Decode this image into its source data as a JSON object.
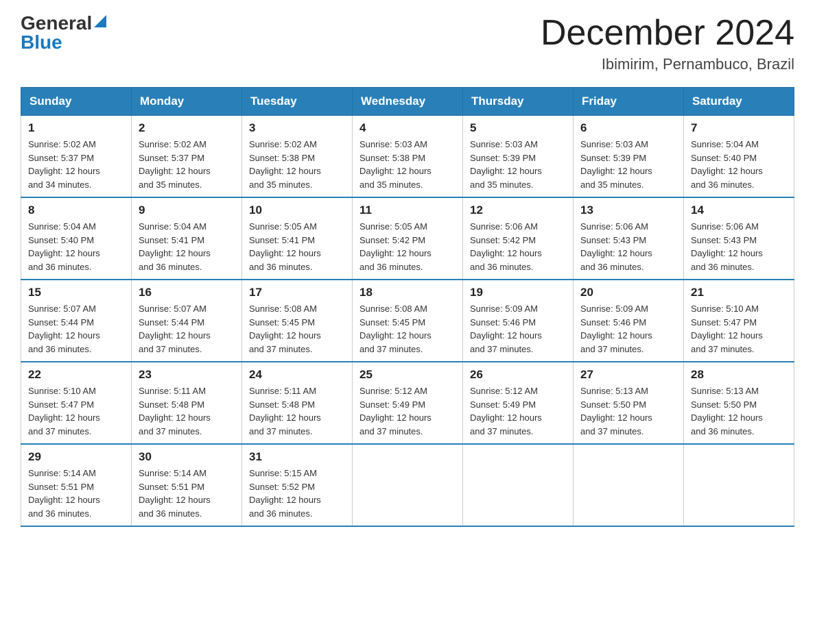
{
  "header": {
    "logo": {
      "general": "General",
      "blue": "Blue",
      "aria": "GeneralBlue logo"
    },
    "title": "December 2024",
    "subtitle": "Ibimirim, Pernambuco, Brazil"
  },
  "weekdays": [
    "Sunday",
    "Monday",
    "Tuesday",
    "Wednesday",
    "Thursday",
    "Friday",
    "Saturday"
  ],
  "weeks": [
    [
      {
        "day": "1",
        "sunrise": "5:02 AM",
        "sunset": "5:37 PM",
        "daylight": "12 hours and 34 minutes."
      },
      {
        "day": "2",
        "sunrise": "5:02 AM",
        "sunset": "5:37 PM",
        "daylight": "12 hours and 35 minutes."
      },
      {
        "day": "3",
        "sunrise": "5:02 AM",
        "sunset": "5:38 PM",
        "daylight": "12 hours and 35 minutes."
      },
      {
        "day": "4",
        "sunrise": "5:03 AM",
        "sunset": "5:38 PM",
        "daylight": "12 hours and 35 minutes."
      },
      {
        "day": "5",
        "sunrise": "5:03 AM",
        "sunset": "5:39 PM",
        "daylight": "12 hours and 35 minutes."
      },
      {
        "day": "6",
        "sunrise": "5:03 AM",
        "sunset": "5:39 PM",
        "daylight": "12 hours and 35 minutes."
      },
      {
        "day": "7",
        "sunrise": "5:04 AM",
        "sunset": "5:40 PM",
        "daylight": "12 hours and 36 minutes."
      }
    ],
    [
      {
        "day": "8",
        "sunrise": "5:04 AM",
        "sunset": "5:40 PM",
        "daylight": "12 hours and 36 minutes."
      },
      {
        "day": "9",
        "sunrise": "5:04 AM",
        "sunset": "5:41 PM",
        "daylight": "12 hours and 36 minutes."
      },
      {
        "day": "10",
        "sunrise": "5:05 AM",
        "sunset": "5:41 PM",
        "daylight": "12 hours and 36 minutes."
      },
      {
        "day": "11",
        "sunrise": "5:05 AM",
        "sunset": "5:42 PM",
        "daylight": "12 hours and 36 minutes."
      },
      {
        "day": "12",
        "sunrise": "5:06 AM",
        "sunset": "5:42 PM",
        "daylight": "12 hours and 36 minutes."
      },
      {
        "day": "13",
        "sunrise": "5:06 AM",
        "sunset": "5:43 PM",
        "daylight": "12 hours and 36 minutes."
      },
      {
        "day": "14",
        "sunrise": "5:06 AM",
        "sunset": "5:43 PM",
        "daylight": "12 hours and 36 minutes."
      }
    ],
    [
      {
        "day": "15",
        "sunrise": "5:07 AM",
        "sunset": "5:44 PM",
        "daylight": "12 hours and 36 minutes."
      },
      {
        "day": "16",
        "sunrise": "5:07 AM",
        "sunset": "5:44 PM",
        "daylight": "12 hours and 37 minutes."
      },
      {
        "day": "17",
        "sunrise": "5:08 AM",
        "sunset": "5:45 PM",
        "daylight": "12 hours and 37 minutes."
      },
      {
        "day": "18",
        "sunrise": "5:08 AM",
        "sunset": "5:45 PM",
        "daylight": "12 hours and 37 minutes."
      },
      {
        "day": "19",
        "sunrise": "5:09 AM",
        "sunset": "5:46 PM",
        "daylight": "12 hours and 37 minutes."
      },
      {
        "day": "20",
        "sunrise": "5:09 AM",
        "sunset": "5:46 PM",
        "daylight": "12 hours and 37 minutes."
      },
      {
        "day": "21",
        "sunrise": "5:10 AM",
        "sunset": "5:47 PM",
        "daylight": "12 hours and 37 minutes."
      }
    ],
    [
      {
        "day": "22",
        "sunrise": "5:10 AM",
        "sunset": "5:47 PM",
        "daylight": "12 hours and 37 minutes."
      },
      {
        "day": "23",
        "sunrise": "5:11 AM",
        "sunset": "5:48 PM",
        "daylight": "12 hours and 37 minutes."
      },
      {
        "day": "24",
        "sunrise": "5:11 AM",
        "sunset": "5:48 PM",
        "daylight": "12 hours and 37 minutes."
      },
      {
        "day": "25",
        "sunrise": "5:12 AM",
        "sunset": "5:49 PM",
        "daylight": "12 hours and 37 minutes."
      },
      {
        "day": "26",
        "sunrise": "5:12 AM",
        "sunset": "5:49 PM",
        "daylight": "12 hours and 37 minutes."
      },
      {
        "day": "27",
        "sunrise": "5:13 AM",
        "sunset": "5:50 PM",
        "daylight": "12 hours and 37 minutes."
      },
      {
        "day": "28",
        "sunrise": "5:13 AM",
        "sunset": "5:50 PM",
        "daylight": "12 hours and 36 minutes."
      }
    ],
    [
      {
        "day": "29",
        "sunrise": "5:14 AM",
        "sunset": "5:51 PM",
        "daylight": "12 hours and 36 minutes."
      },
      {
        "day": "30",
        "sunrise": "5:14 AM",
        "sunset": "5:51 PM",
        "daylight": "12 hours and 36 minutes."
      },
      {
        "day": "31",
        "sunrise": "5:15 AM",
        "sunset": "5:52 PM",
        "daylight": "12 hours and 36 minutes."
      },
      null,
      null,
      null,
      null
    ]
  ]
}
